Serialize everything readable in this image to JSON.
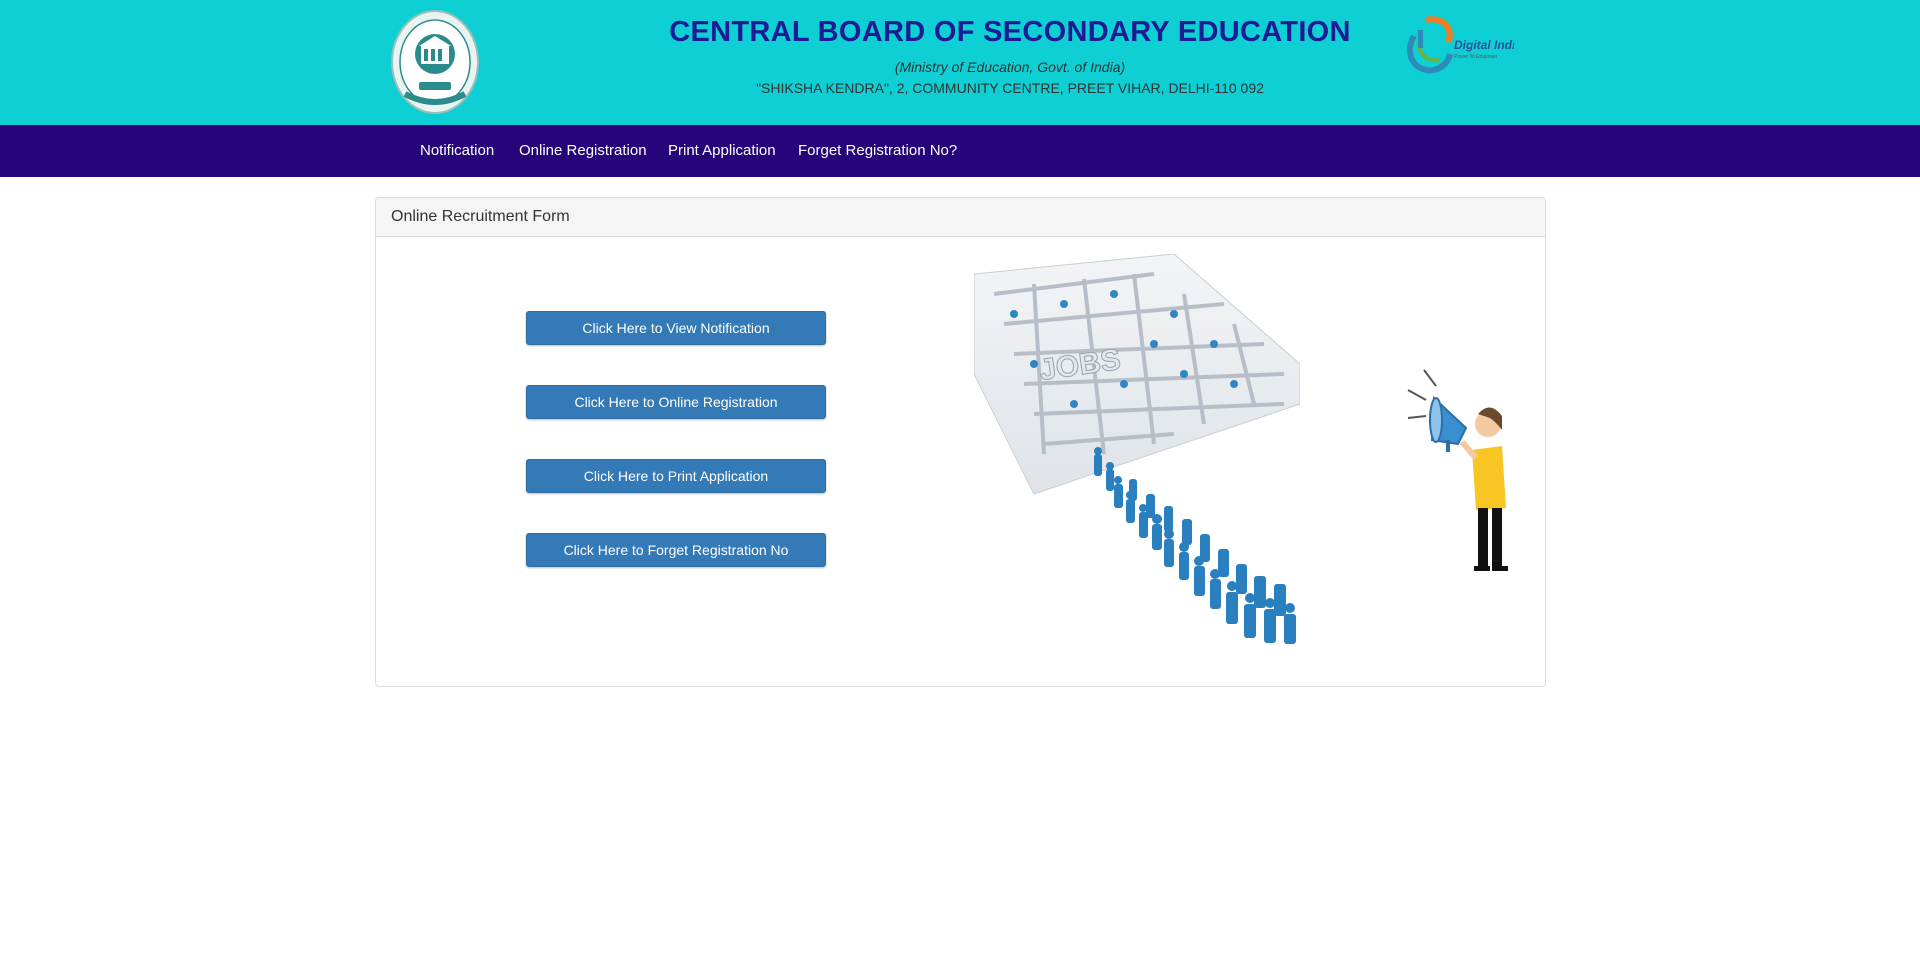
{
  "header": {
    "title": "CENTRAL BOARD OF SECONDARY EDUCATION",
    "ministry": "(Ministry of Education, Govt. of India)",
    "address": "\"SHIKSHA KENDRA\", 2, COMMUNITY CENTRE, PREET VIHAR, DELHI-110 092",
    "digital_india_label": "Digital India",
    "digital_india_tagline": "Power To Empower"
  },
  "nav": {
    "items": [
      {
        "label": "Notification"
      },
      {
        "label": "Online Registration"
      },
      {
        "label": "Print Application"
      },
      {
        "label": "Forget Registration No?"
      }
    ]
  },
  "panel": {
    "heading": "Online Recruitment Form",
    "buttons": [
      {
        "label": "Click Here to View Notification"
      },
      {
        "label": "Click Here to Online Registration"
      },
      {
        "label": "Click Here to Print Application"
      },
      {
        "label": "Click Here to Forget Registration No"
      }
    ],
    "maze_text": "JOBS"
  },
  "colors": {
    "header_bg": "#0ecfd3",
    "title": "#1d1c94",
    "nav_bg": "#250579",
    "button_bg": "#337ab7"
  }
}
